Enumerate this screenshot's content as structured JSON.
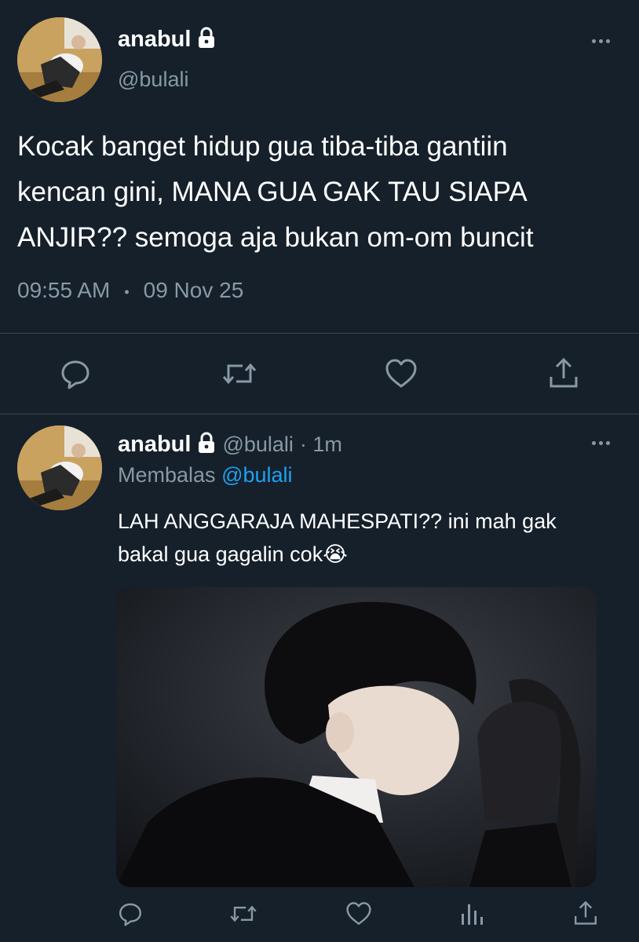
{
  "main_tweet": {
    "display_name": "anabul",
    "handle": "@bulali",
    "text_lines": [
      "Kocak banget hidup gua tiba-tiba gantiin",
      "kencan gini, MANA GUA GAK TAU SIAPA",
      "ANJIR?? semoga aja bukan om-om buncit"
    ],
    "time": "09:55 AM",
    "separator": "•",
    "date": "09 Nov 25",
    "icons": [
      "reply-icon",
      "retweet-icon",
      "like-icon",
      "share-icon"
    ]
  },
  "reply_tweet": {
    "display_name": "anabul",
    "handle": "@bulali",
    "time_ago": "· 1m",
    "replying_label": "Membalas",
    "replying_to": "@bulali",
    "text_lines": [
      "LAH ANGGARAJA MAHESPATI?? ini mah gak",
      "bakal gua gagalin cok😭"
    ],
    "icons": [
      "reply-icon",
      "retweet-icon",
      "like-icon",
      "views-icon",
      "share-icon"
    ]
  },
  "colors": {
    "background": "#15202b",
    "text": "#ffffff",
    "muted": "#8899a6",
    "link": "#1da1f2",
    "divider": "#38444d"
  }
}
